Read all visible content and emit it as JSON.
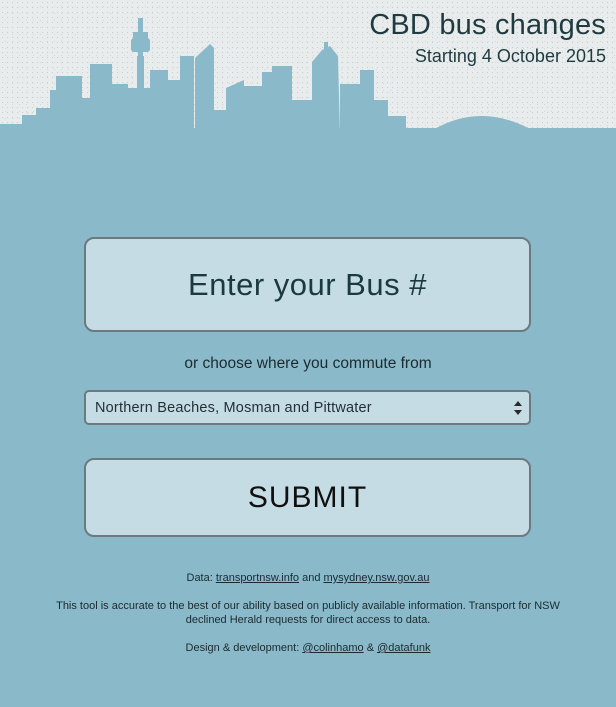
{
  "header": {
    "title": "CBD bus changes",
    "subtitle": "Starting 4 October 2015"
  },
  "form": {
    "bus_placeholder": "Enter your Bus #",
    "or_text": "or choose where you commute from",
    "region_selected": "Northern Beaches, Mosman and Pittwater",
    "submit_label": "SUBMIT"
  },
  "footer": {
    "data_prefix": "Data:",
    "data_link1": "transportnsw.info",
    "data_and": "and",
    "data_link2": "mysydney.nsw.gov.au",
    "disclaimer": "This tool is accurate to the best of our ability based on publicly available information. Transport for NSW declined Herald requests for direct access to data.",
    "credit_prefix": "Design & development:",
    "credit_link1": "@colinhamo",
    "credit_amp": "&",
    "credit_link2": "@datafunk"
  },
  "colors": {
    "background": "#8ab9c9",
    "sky": "#e9ecec",
    "field": "#c6dce4",
    "border": "#6b7a7f",
    "text": "#1b3940"
  }
}
